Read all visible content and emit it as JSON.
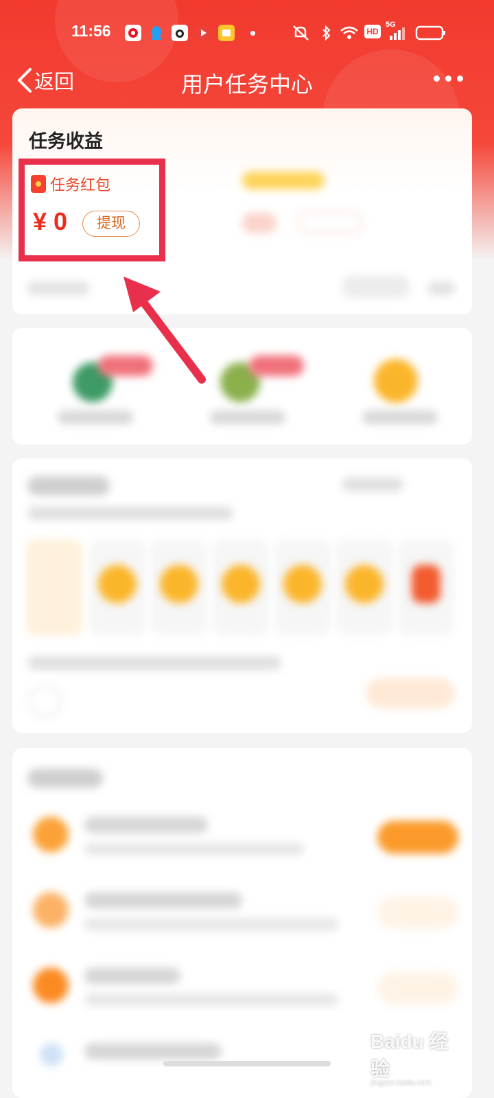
{
  "status_bar": {
    "time": "11:56",
    "network": "5G",
    "hd_label": "HD"
  },
  "nav": {
    "back_label": "返回",
    "title": "用户任务中心"
  },
  "earnings": {
    "title": "任务收益",
    "red_packet_label": "任务红包",
    "amount": "¥ 0",
    "withdraw_label": "提现"
  },
  "watermark": {
    "brand": "Baidu 经验",
    "site": "jingyan.baidu.com"
  },
  "colors": {
    "header_red": "#f23a2f",
    "highlight_border": "#e8304c",
    "amount_red": "#ee2b1f",
    "withdraw_border": "#e88b48",
    "coin_orange": "#fbb52a"
  }
}
